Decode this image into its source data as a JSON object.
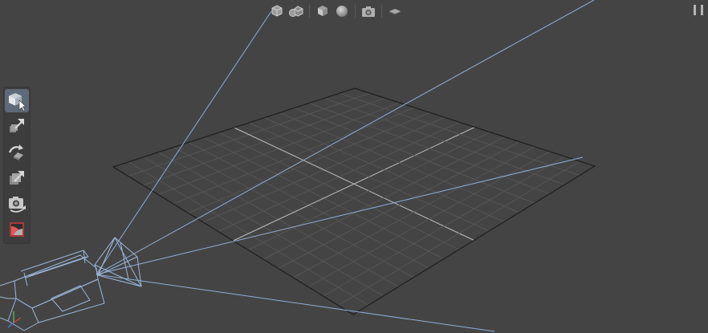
{
  "top_toolbar": {
    "buttons": [
      {
        "name": "single-object-icon"
      },
      {
        "name": "multiple-objects-icon"
      },
      {
        "name": "cube-shape-icon"
      },
      {
        "name": "sphere-shape-icon"
      },
      {
        "name": "camera-view-icon"
      },
      {
        "name": "floor-plane-icon"
      }
    ]
  },
  "left_toolbar": {
    "active_tool": "select-tool",
    "tools": [
      {
        "name": "select-tool"
      },
      {
        "name": "move-tool"
      },
      {
        "name": "rotate-tool"
      },
      {
        "name": "scale-tool"
      },
      {
        "name": "orbit-camera-tool"
      },
      {
        "name": "material-tool"
      }
    ]
  },
  "colors": {
    "background": "#444444",
    "grid_line": "#555555",
    "grid_border": "#1e1e1e",
    "grid_axis": "#bdbdbd",
    "camera_wire": "#9ab7dc",
    "camera_frustum": "#7f9cc6",
    "active_tool": "#5e6a78",
    "axis_x": "#e0413a",
    "axis_y": "#5fc253",
    "axis_z": "#4a7de0"
  },
  "scene": {
    "grid_divisions": 16
  }
}
